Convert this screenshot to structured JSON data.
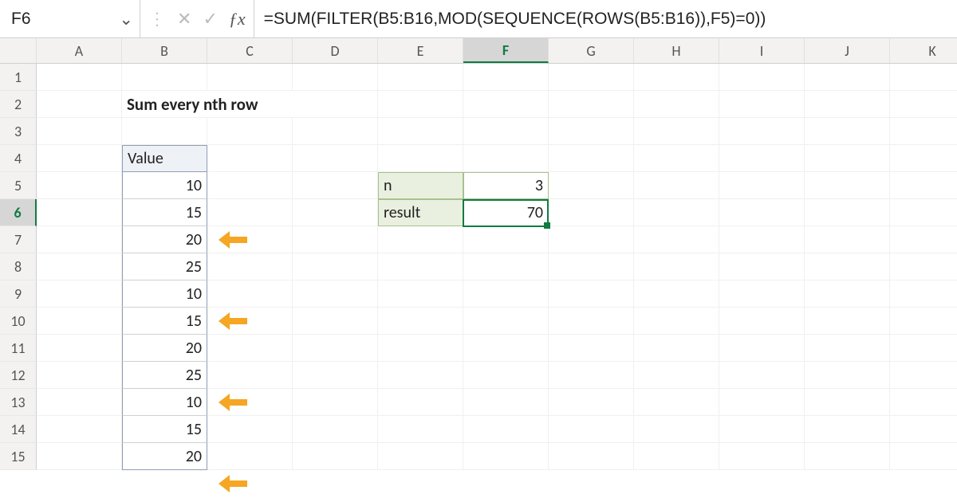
{
  "nameBox": "F6",
  "formula": "=SUM(FILTER(B5:B16,MOD(SEQUENCE(ROWS(B5:B16)),F5)=0))",
  "columns": [
    "A",
    "B",
    "C",
    "D",
    "E",
    "F",
    "G",
    "H",
    "I",
    "J",
    "K"
  ],
  "rows": [
    "1",
    "2",
    "3",
    "4",
    "5",
    "6",
    "7",
    "8",
    "9",
    "10",
    "11",
    "12",
    "13",
    "14",
    "15"
  ],
  "selected": {
    "col": "F",
    "row": "6"
  },
  "title": "Sum every nth row",
  "valueHeader": "Value",
  "values": [
    "10",
    "15",
    "20",
    "25",
    "10",
    "15",
    "20",
    "25",
    "10",
    "15",
    "20"
  ],
  "nLabel": "n",
  "nValue": "3",
  "resultLabel": "result",
  "resultValue": "70",
  "arrowRows": [
    7,
    10,
    13
  ],
  "icons": {
    "chevron": "⌄",
    "cancel": "✕",
    "enter": "✓"
  }
}
